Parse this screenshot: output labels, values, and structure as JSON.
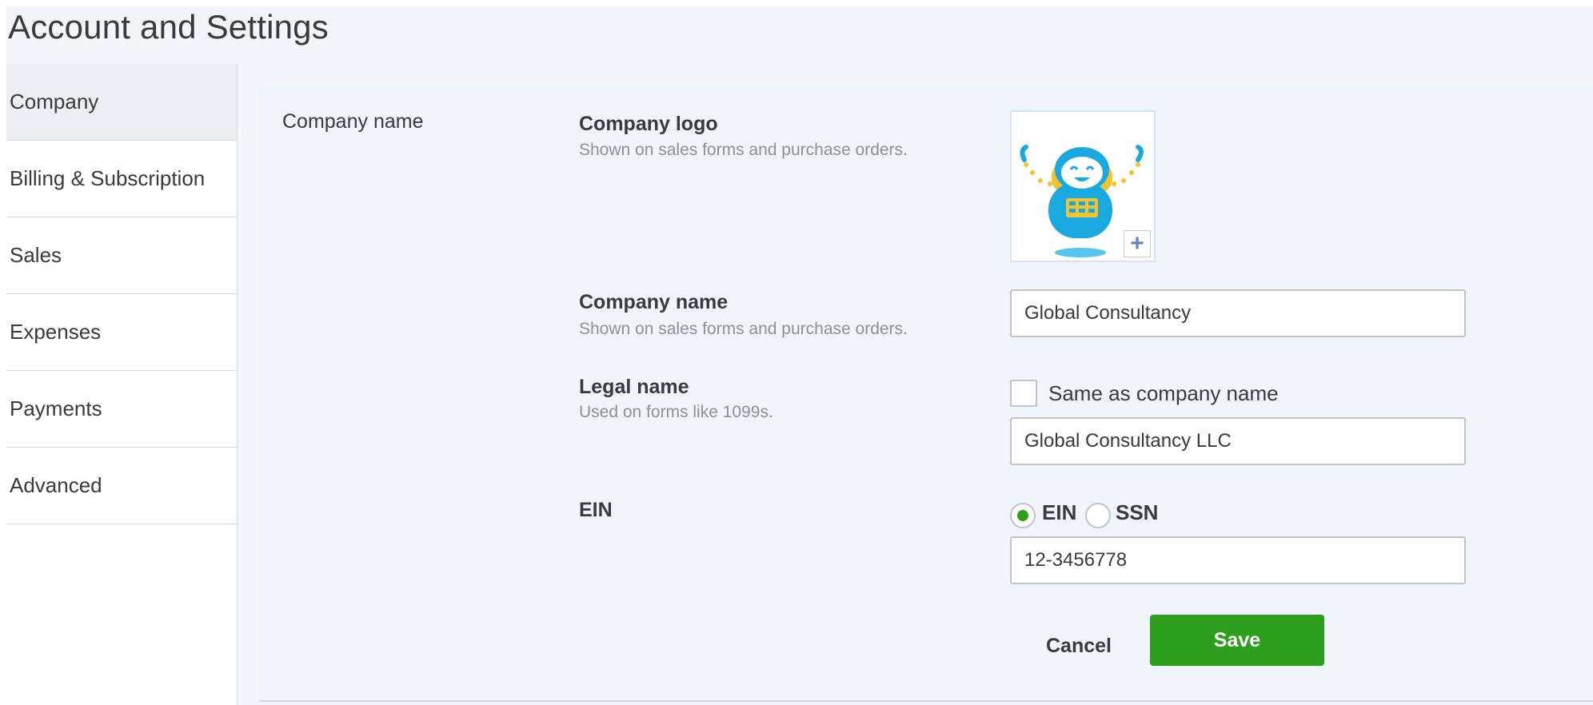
{
  "page": {
    "title": "Account and Settings"
  },
  "sidebar": {
    "items": [
      {
        "label": "Company",
        "active": true
      },
      {
        "label": "Billing & Subscription",
        "active": false
      },
      {
        "label": "Sales",
        "active": false
      },
      {
        "label": "Expenses",
        "active": false
      },
      {
        "label": "Payments",
        "active": false
      },
      {
        "label": "Advanced",
        "active": false
      }
    ]
  },
  "company_section": {
    "title": "Company name",
    "logo": {
      "label": "Company logo",
      "help": "Shown on sales forms and purchase orders.",
      "add_icon": "plus-icon"
    },
    "company_name": {
      "label": "Company name",
      "help": "Shown on sales forms and purchase orders.",
      "value": "Global Consultancy"
    },
    "legal_name": {
      "label": "Legal name",
      "help": "Used on forms like 1099s.",
      "same_as_label": "Same as company name",
      "same_as_checked": false,
      "value": "Global Consultancy LLC"
    },
    "ein": {
      "label": "EIN",
      "options": [
        {
          "label": "EIN",
          "selected": true
        },
        {
          "label": "SSN",
          "selected": false
        }
      ],
      "value": "12-3456778"
    },
    "actions": {
      "cancel_label": "Cancel",
      "save_label": "Save"
    }
  },
  "colors": {
    "accent": "#2ca01c",
    "panel_bg": "#f0f5fc",
    "text": "#393a3d",
    "muted": "#8d9096"
  }
}
